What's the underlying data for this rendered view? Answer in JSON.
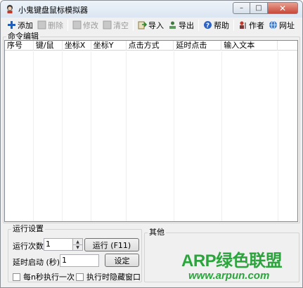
{
  "window": {
    "title": "小鬼键盘鼠标模拟器",
    "controls": {
      "minimize": "–",
      "maximize": "□",
      "close": "✕"
    }
  },
  "toolbar": {
    "items": [
      {
        "label": "添加",
        "icon": "plus-icon",
        "enabled": true
      },
      {
        "label": "删除",
        "icon": "delete-icon",
        "enabled": false
      },
      {
        "label": "修改",
        "icon": "edit-icon",
        "enabled": false
      },
      {
        "label": "清空",
        "icon": "clear-icon",
        "enabled": false
      },
      {
        "label": "导入",
        "icon": "import-icon",
        "enabled": true
      },
      {
        "label": "导出",
        "icon": "export-icon",
        "enabled": true
      },
      {
        "label": "帮助",
        "icon": "help-icon",
        "enabled": true
      },
      {
        "label": "作者",
        "icon": "author-icon",
        "enabled": true
      },
      {
        "label": "网址",
        "icon": "globe-icon",
        "enabled": true
      }
    ]
  },
  "command_group": {
    "label": "命令编辑",
    "columns": [
      "序号",
      "键/鼠",
      "坐标X",
      "坐标Y",
      "点击方式",
      "延时点击",
      "输入文本"
    ],
    "rows": []
  },
  "run_group": {
    "label": "运行设置",
    "run_count_label": "运行次数:",
    "run_count_value": "1",
    "run_button": "运行 (F11)",
    "delay_label": "延时启动 (秒):",
    "delay_value": "1",
    "set_button": "设定",
    "checkbox_per_n_seconds": "每n秒执行一次",
    "checkbox_hide_window": "执行时隐藏窗口"
  },
  "other_group": {
    "label": "其他"
  },
  "watermark": {
    "main": "ARP绿色联盟",
    "url": "www.arpun.com"
  },
  "colors": {
    "accent_green": "#2aa53b"
  }
}
